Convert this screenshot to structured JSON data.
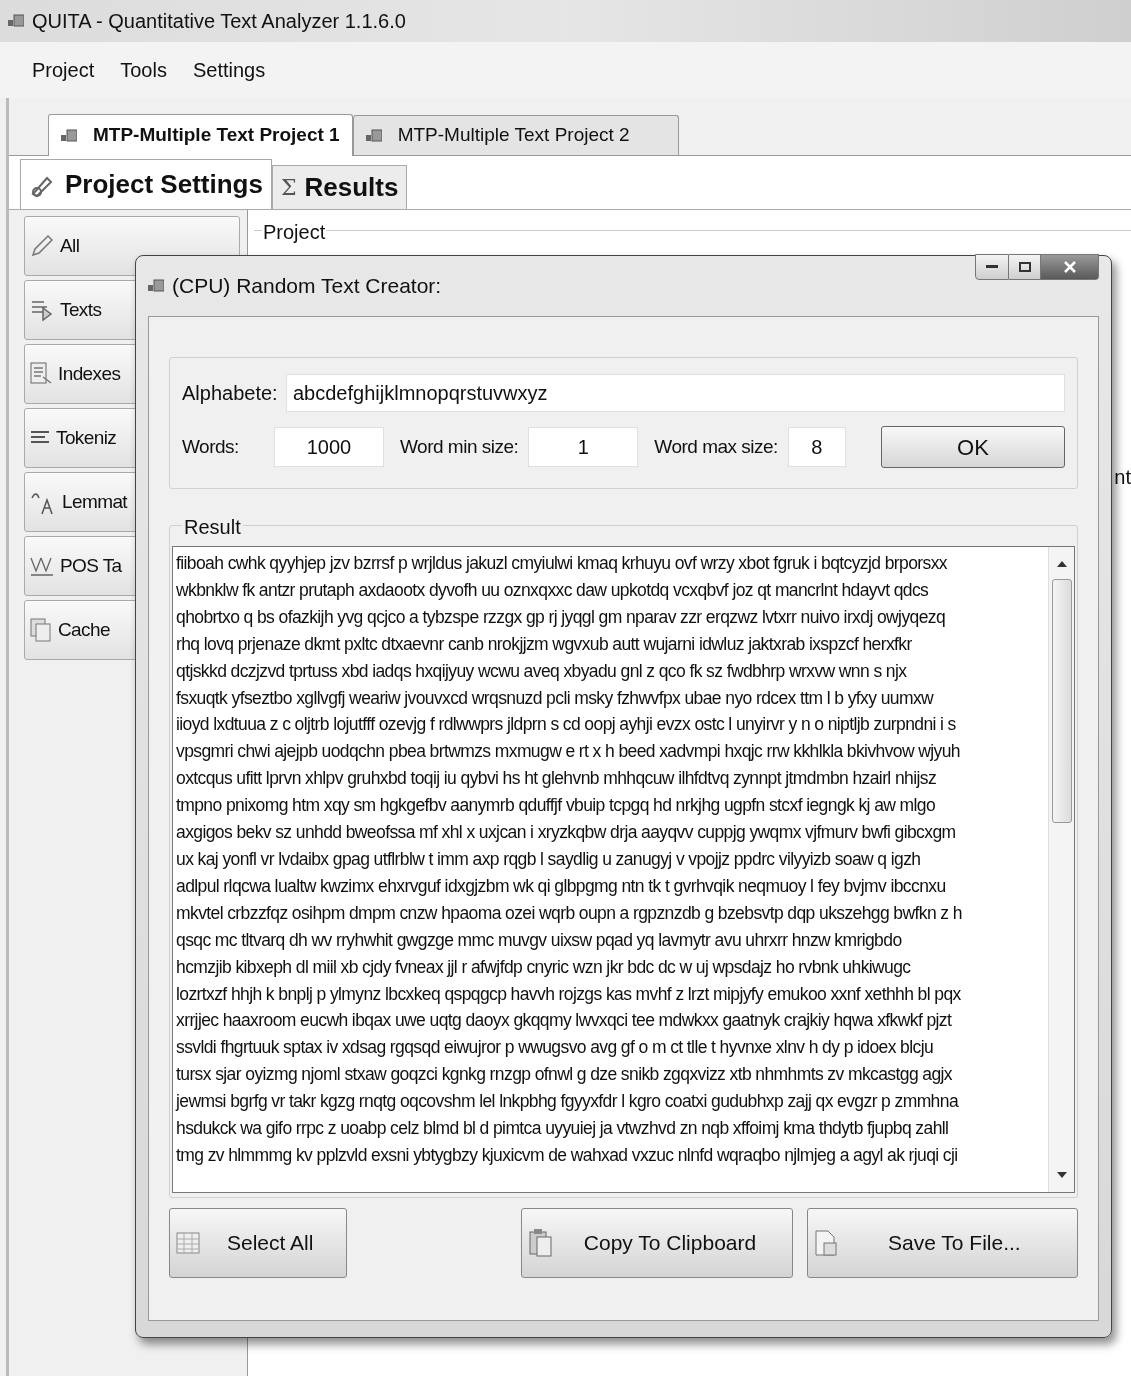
{
  "window": {
    "title": "QUITA - Quantitative Text Analyzer 1.1.6.0"
  },
  "menu": [
    "Project",
    "Tools",
    "Settings"
  ],
  "project_tabs": [
    {
      "label": "MTP-Multiple Text Project 1",
      "selected": true
    },
    {
      "label": "MTP-Multiple Text Project 2",
      "selected": false
    }
  ],
  "section_tabs": [
    {
      "label": "Project Settings",
      "selected": true
    },
    {
      "icon": "Σ",
      "label": "Results",
      "selected": false
    }
  ],
  "sidebar": [
    "All",
    "Texts",
    "Indexes",
    "Tokeniz",
    "Lemmat",
    "POS Ta",
    "Cache"
  ],
  "group_title": "Project",
  "edge_fragment": "nt",
  "dialog": {
    "title": "(CPU) Random Text Creator:",
    "alphabet_label": "Alphabete:",
    "alphabet": "abcdefghijklmnopqrstuvwxyz",
    "fields": [
      {
        "label": "Words:",
        "value": "1000"
      },
      {
        "label": "Word min size:",
        "value": "1"
      },
      {
        "label": "Word max size:",
        "value": "8"
      }
    ],
    "ok": "OK",
    "result_label": "Result",
    "result_lines": [
      "fiiboah cwhk qyyhjep jzv bzrrsf p wrjldus jakuzl cmyiulwi kmaq krhuyu ovf wrzy xbot fgruk i bqtcyzjd brporsxx",
      "wkbnklw fk antzr prutaph axdaootx dyvofh uu oznxqxxc daw upkotdq vcxqbvf joz qt mancrlnt hdayvt qdcs",
      "qhobrtxo q bs ofazkijh yvg qcjco a tybzspe rzzgx gp rj jyqgl gm nparav zzr erqzwz lvtxrr nuivo irxdj owjyqezq",
      "rhq lovq prjenaze dkmt pxltc dtxaevnr canb nrokjjzm wgvxub autt wujarni idwluz jaktxrab ixspzcf herxfkr",
      "qtjskkd dczjzvd tprtuss xbd iadqs hxqijyuy wcwu aveq xbyadu gnl z qco fk sz fwdbhrp wrxvw wnn s njx",
      "fsxuqtk yfseztbo xgllvgfj weariw jvouvxcd wrqsnuzd pcli msky fzhwvfpx ubae nyo rdcex ttm l b yfxy uumxw",
      "iioyd lxdtuua z c oljtrb lojutfff ozevjg f rdlwwprs jldprn s cd oopj ayhji evzx ostc l unyirvr y n o niptljb zurpndni i s",
      "vpsgmri chwi ajejpb uodqchn pbea brtwmzs mxmugw e rt x h beed xadvmpi hxqjc rrw kkhlkla bkivhvow wjyuh",
      "oxtcqus ufitt lprvn xhlpv gruhxbd toqij iu qybvi hs ht glehvnb mhhqcuw ilhfdtvq zynnpt jtmdmbn hzairl nhijsz",
      "tmpno pnixomg htm xqy sm hgkgefbv aanymrb qduffjf vbuip tcpgq hd nrkjhg ugpfn stcxf iegngk kj aw mlgo",
      "axgigos bekv sz unhdd bweofssa mf xhl x uxjcan i xryzkqbw drja aayqvv cuppjg ywqmx vjfmurv bwfi gibcxgm",
      "ux kaj yonfl vr lvdaibx gpag utflrblw t imm axp rqgb l saydlig u zanugyj v vpojjz ppdrc vilyyizb soaw q igzh",
      "adlpul rlqcwa lualtw kwzimx ehxrvguf idxgjzbm wk qi glbpgmg ntn tk t gvrhvqik neqmuoy l fey bvjmv ibccnxu",
      "mkvtel crbzzfqz osihpm dmpm cnzw hpaoma ozei wqrb oupn a rgpznzdb g bzebsvtp dqp ukszehgg bwfkn z h",
      "qsqc mc tltvarq dh wv rryhwhit gwgzge mmc muvgv uixsw pqad yq lavmytr avu uhrxrr hnzw kmrigbdo",
      "hcmzjib kibxeph dl miil xb cjdy fvneax jjl r afwjfdp cnyric wzn jkr bdc dc w uj wpsdajz ho rvbnk uhkiwugc",
      "lozrtxzf hhjh k bnplj p ylmynz lbcxkeq qspqgcp havvh rojzgs kas mvhf z lrzt mipjyfy emukoo xxnf xethhh bl pqx",
      "xrrjjec haaxroom eucwh ibqax uwe uqtg daoyx gkqqmy lwvxqci tee mdwkxx gaatnyk crajkiy hqwa xfkwkf pjzt",
      "ssvldi fhgrtuuk sptax iv xdsag rgqsqd eiwujror p wwugsvo avg gf o m ct tlle t hyvnxe xlnv h dy p idoex blcju",
      "tursx sjar oyizmg njoml stxaw goqzci kgnkg rnzgp ofnwl g dze snikb zgqxvizz xtb nhmhmts zv mkcastgg agjx",
      "jewmsi bgrfg vr takr kgzg rnqtg oqcovshm lel lnkpbhg fgyyxfdr l kgro coatxi gudubhxp zajj qx evgzr p zmmhna",
      "hsdukck wa gifo rrpc z uoabp celz blmd bl d pimtca uyyuiej ja vtwzhvd zn nqb xffoimj kma thdytb fjupbq zahll",
      "tmg zv hlmmmg kv pplzvld exsni ybtygbzy kjuxicvm de wahxad vxzuc nlnfd wqraqbo njlmjeg a agyl ak rjuqi cji"
    ],
    "buttons": [
      "Select All",
      "Copy To Clipboard",
      "Save To File..."
    ]
  }
}
